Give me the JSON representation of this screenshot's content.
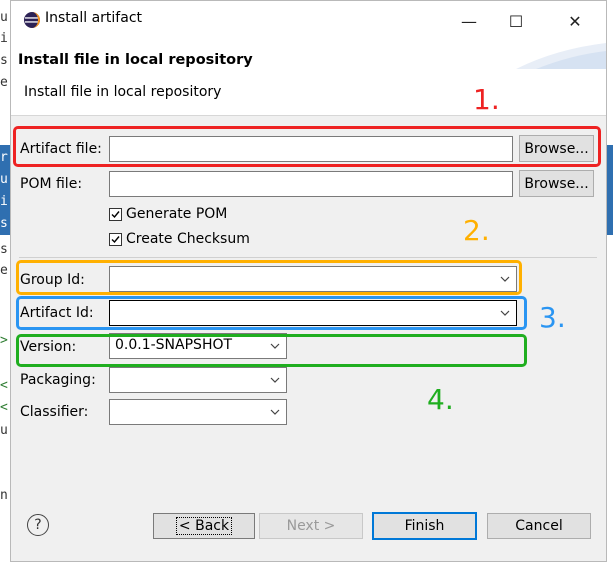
{
  "window": {
    "title": "Install artifact",
    "minimize_label": "—",
    "maximize_label": "☐",
    "close_label": "✕"
  },
  "header": {
    "title": "Install file in local repository",
    "description": "Install file in local repository"
  },
  "form": {
    "artifact_file": {
      "label": "Artifact file:",
      "value": "",
      "browse_label": "Browse..."
    },
    "pom_file": {
      "label": "POM file:",
      "value": "",
      "browse_label": "Browse..."
    },
    "generate_pom": {
      "label": "Generate POM",
      "checked": true
    },
    "create_checksum": {
      "label": "Create Checksum",
      "checked": true
    },
    "group_id": {
      "label": "Group Id:",
      "value": ""
    },
    "artifact_id": {
      "label": "Artifact Id:",
      "value": ""
    },
    "version": {
      "label": "Version:",
      "value": "0.0.1-SNAPSHOT"
    },
    "packaging": {
      "label": "Packaging:",
      "value": ""
    },
    "classifier": {
      "label": "Classifier:",
      "value": ""
    }
  },
  "annotations": [
    {
      "number": "1.",
      "color": "#ee2222"
    },
    {
      "number": "2.",
      "color": "#ffb000"
    },
    {
      "number": "3.",
      "color": "#2a95f2"
    },
    {
      "number": "4.",
      "color": "#1fae1f"
    }
  ],
  "footer": {
    "help_label": "?",
    "back_label": "< Back",
    "next_label": "Next >",
    "finish_label": "Finish",
    "cancel_label": "Cancel"
  },
  "background_editor_chars": [
    "u",
    "i",
    "s",
    "e",
    "r",
    "u",
    "i",
    "s",
    "s",
    "e",
    ">",
    "<",
    "<",
    "u",
    "n"
  ]
}
